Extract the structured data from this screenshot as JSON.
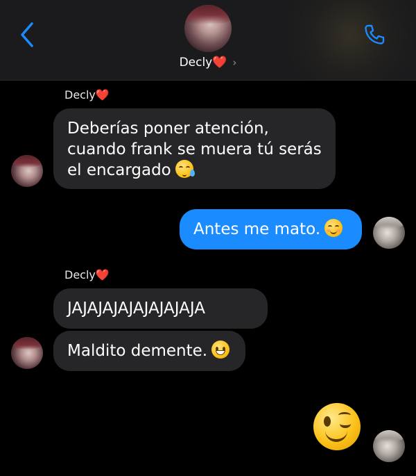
{
  "header": {
    "contact_name": "Decly",
    "contact_heart": "❤️",
    "chevron": "›",
    "back_icon": "chevron-left-icon",
    "call_icon": "phone-icon",
    "accent_color": "#1a8cff"
  },
  "messages": [
    {
      "sender": "Decly",
      "sender_heart": "❤️",
      "lines": [
        "Deberías poner atención,",
        "cuando frank se muera tú serás",
        "el encargado"
      ],
      "emoji": "sleepy-face-emoji"
    },
    {
      "sender": "me",
      "lines": [
        "Antes me mato."
      ],
      "emoji": "smiling-face-with-smiling-eyes-emoji"
    },
    {
      "sender": "Decly",
      "sender_heart": "❤️",
      "lines": [
        "JAJAJAJAJAJAJAJAJA"
      ]
    },
    {
      "sender": "Decly",
      "lines": [
        "Maldito demente."
      ],
      "emoji": "grinning-face-emoji"
    },
    {
      "sender": "me",
      "emoji": "winking-face-emoji"
    }
  ],
  "colors": {
    "incoming_bubble": "#262629",
    "outgoing_bubble": "#1a8cff",
    "heart": "#e0252e"
  }
}
